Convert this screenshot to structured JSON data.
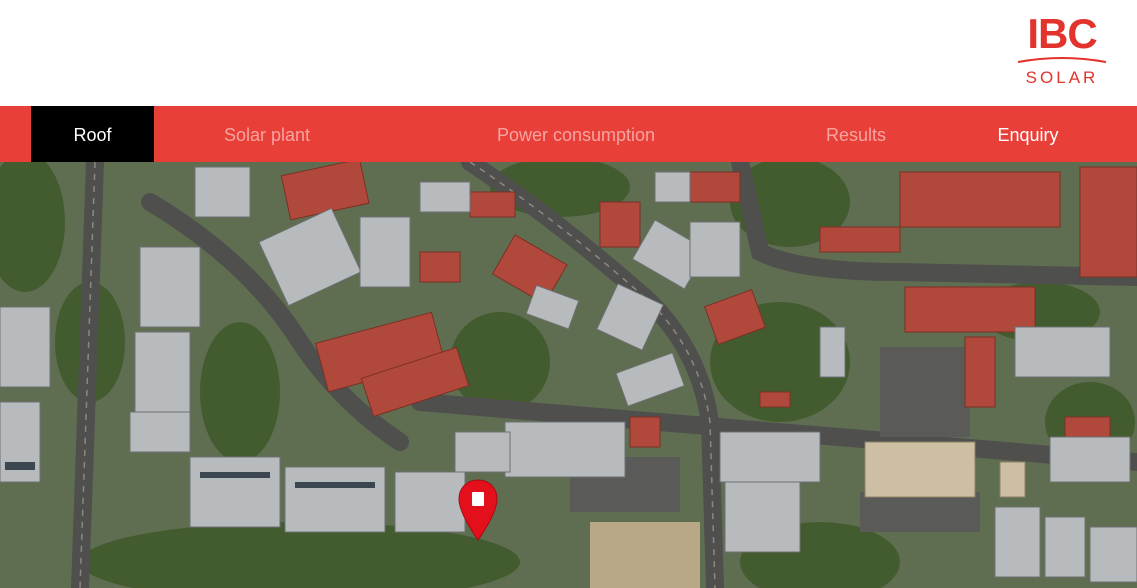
{
  "brand": {
    "logo_main": "IBC",
    "logo_sub": "SOLAR",
    "color": "#e2332d"
  },
  "nav": {
    "background": "#e83f38",
    "tabs": [
      {
        "label": "Roof",
        "state": "active"
      },
      {
        "label": "Solar plant",
        "state": "disabled"
      },
      {
        "label": "Power consumption",
        "state": "disabled"
      },
      {
        "label": "Results",
        "state": "disabled"
      },
      {
        "label": "Enquiry",
        "state": "enabled"
      }
    ]
  },
  "map": {
    "type": "satellite",
    "marker": {
      "icon": "map-pin-icon",
      "color": "#e3101c"
    }
  }
}
